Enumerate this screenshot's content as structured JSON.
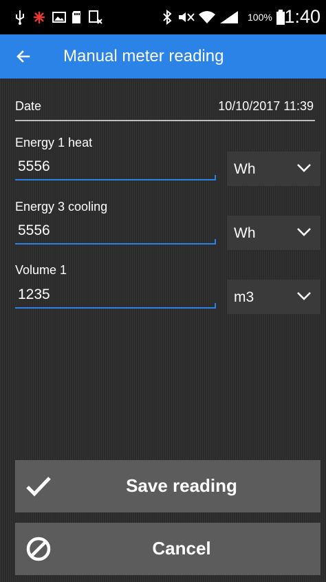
{
  "status_bar": {
    "battery_percent": "100%",
    "time": "11:40"
  },
  "app_bar": {
    "title": "Manual meter reading",
    "back_icon": "arrow-left-icon"
  },
  "date": {
    "label": "Date",
    "value": "10/10/2017 11:39"
  },
  "fields": [
    {
      "label": "Energy 1 heat",
      "value": "5556",
      "unit": "Wh"
    },
    {
      "label": "Energy 3 cooling",
      "value": "5556",
      "unit": "Wh"
    },
    {
      "label": "Volume 1",
      "value": "1235",
      "unit": "m3"
    }
  ],
  "actions": {
    "save_label": "Save reading",
    "cancel_label": "Cancel"
  },
  "colors": {
    "accent": "#2b83e8",
    "button_bg": "#5c5c5c",
    "status_bar": "#000000"
  }
}
